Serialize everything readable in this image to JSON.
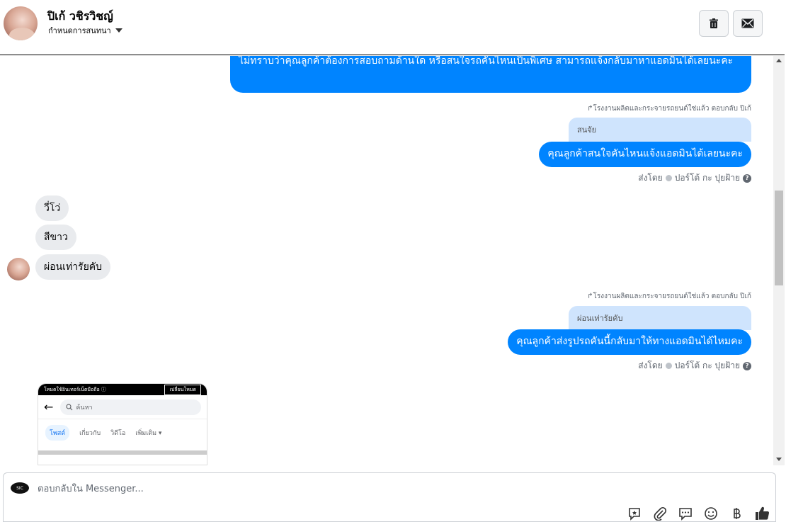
{
  "header": {
    "contact_name": "ปิเก้ วชิรวิชญ์",
    "assign_label": "กำหนดการสนทนา",
    "trash_icon": "trash-icon",
    "mail_icon": "mail-icon"
  },
  "messages": {
    "out_1": "ไม่ทราบว่าคุณลูกค้าต้องการสอบถามด้านใด หรือสนใจรถคันไหนเป็นพิเศษ สามารถแจ้งกลับมาหาแอดมินได้เลยนะคะ",
    "reply_meta_1": "↱โรงงานผลิตและกระจายรถยนต์ใช่แล้ว ตอบกลับ ปิเก้",
    "quote_1": "สนจัย",
    "out_2": "คุณลูกค้าสนใจคันไหนแจ้งแอดมินได้เลยนะคะ",
    "sent_by_1": "ส่งโดย",
    "sender_1": "ปอร์โต้ กะ ปุยฝ้าย",
    "in_1": "วี่โว่",
    "in_2": "สีขาว",
    "in_3": "ผ่อนเท่ารัยคับ",
    "reply_meta_2": "↱โรงงานผลิตและกระจายรถยนต์ใช่แล้ว ตอบกลับ ปิเก้",
    "quote_2": "ผ่อนเท่ารัยคับ",
    "out_3": "คุณลูกค้าส่งรูปรถคันนี้กลับมาให้ทางแอดมินได้ไหมคะ",
    "sent_by_2": "ส่งโดย",
    "sender_2": "ปอร์โต้ กะ ปุยฝ้าย",
    "help_glyph": "?"
  },
  "attachment": {
    "topbar_left": "โหมดใช้อินเทอร์เน็ตมือถือ ⓘ",
    "topbar_right": "เปลี่ยนโหมด",
    "search_placeholder": "ค้นหา",
    "tabs": [
      "โพสต์",
      "เกี่ยวกับ",
      "วิดีโอ",
      "เพิ่มเติม"
    ]
  },
  "composer": {
    "placeholder": "ตอบกลับใน Messenger...",
    "avatar_text": "SIC",
    "tools": [
      "saved-reply-icon",
      "attachment-icon",
      "chat-icon",
      "emoji-icon",
      "baht-icon",
      "like-icon"
    ]
  },
  "colors": {
    "accent": "#0084ff",
    "quote_bg": "#cfe4fd",
    "incoming_bg": "#e9ebee"
  }
}
